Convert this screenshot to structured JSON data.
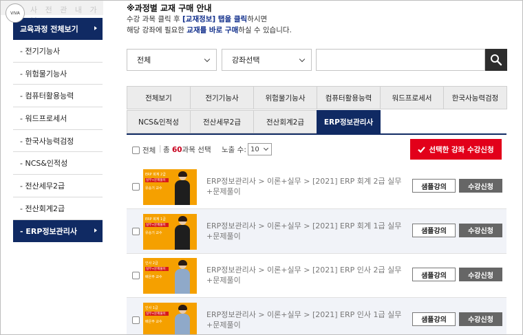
{
  "sidebar": {
    "logo_text": "VIVA",
    "top_faint_text": "사 전 관 내 가 불",
    "header": "교육과정 전체보기",
    "items": [
      {
        "label": "- 전기기능사",
        "active": false
      },
      {
        "label": "- 위험물기능사",
        "active": false
      },
      {
        "label": "- 컴퓨터활용능력",
        "active": false
      },
      {
        "label": "- 워드프로세서",
        "active": false
      },
      {
        "label": "- 한국사능력검정",
        "active": false
      },
      {
        "label": "- NCS&인적성",
        "active": false
      },
      {
        "label": "- 전산세무2급",
        "active": false
      },
      {
        "label": "- 전산회계2급",
        "active": false
      },
      {
        "label": "- ERP정보관리사",
        "active": true
      }
    ]
  },
  "notice": {
    "title": "※과정별 교재 구매 안내",
    "line1_a": "수강 과목 클릭 후 ",
    "line1_b": "[교재정보] 탭을 클릭",
    "line1_c": "하시면",
    "line2_a": "해당 강좌에 필요한 ",
    "line2_b": "교재를 바로 구매",
    "line2_c": "하실 수 있습니다."
  },
  "filters": {
    "category": "전체",
    "course": "강좌선택",
    "search_value": ""
  },
  "tabs": [
    {
      "label": "전체보기",
      "active": false
    },
    {
      "label": "전기기능사",
      "active": false
    },
    {
      "label": "위험물기능사",
      "active": false
    },
    {
      "label": "컴퓨터활용능력",
      "active": false
    },
    {
      "label": "워드프로세서",
      "active": false
    },
    {
      "label": "한국사능력검정",
      "active": false
    },
    {
      "label": "NCS&인적성",
      "active": false
    },
    {
      "label": "전산세무2급",
      "active": false
    },
    {
      "label": "전산회계2급",
      "active": false
    },
    {
      "label": "ERP정보관리사",
      "active": true
    }
  ],
  "list_header": {
    "select_all": "전체",
    "sep": "|",
    "count_prefix": "총 ",
    "count": "60",
    "count_suffix": "과목 선택",
    "expose_label": "노출 수:",
    "expose_value": "10",
    "apply_button": "선택한 강좌 수강신청"
  },
  "courses": [
    {
      "title": "ERP정보관리사 > 이론+실무 > [2021] ERP 회계 2급 실무+문제풀이",
      "thumb_tag": "ERP 회계 2급",
      "thumb_sub": "실무+문제풀이",
      "thumb_prof": "유승기 교수",
      "sample": "샘플강의",
      "enroll": "수강신청",
      "shaded": false,
      "jacket": "#1e1e1e"
    },
    {
      "title": "ERP정보관리사 > 이론+실무 > [2021] ERP 회계 1급 실무+문제풀이",
      "thumb_tag": "ERP 회계 1급",
      "thumb_sub": "실무+문제풀이",
      "thumb_prof": "유승기 교수",
      "sample": "샘플강의",
      "enroll": "수강신청",
      "shaded": true,
      "jacket": "#1e1e1e"
    },
    {
      "title": "ERP정보관리사 > 이론+실무 > [2021] ERP 인사 2급 실무+문제풀이",
      "thumb_tag": "인사 2급",
      "thumb_sub": "실무+문제풀이",
      "thumb_prof": "배은주 교수",
      "sample": "샘플강의",
      "enroll": "수강신청",
      "shaded": false,
      "jacket": "#8fa9c9"
    },
    {
      "title": "ERP정보관리사 > 이론+실무 > [2021] ERP 인사 1급 실무+문제풀이",
      "thumb_tag": "인사 1급",
      "thumb_sub": "실무+문제풀이",
      "thumb_prof": "배은주 교수",
      "sample": "샘플강의",
      "enroll": "수강신청",
      "shaded": true,
      "jacket": "#8fa9c9"
    }
  ]
}
